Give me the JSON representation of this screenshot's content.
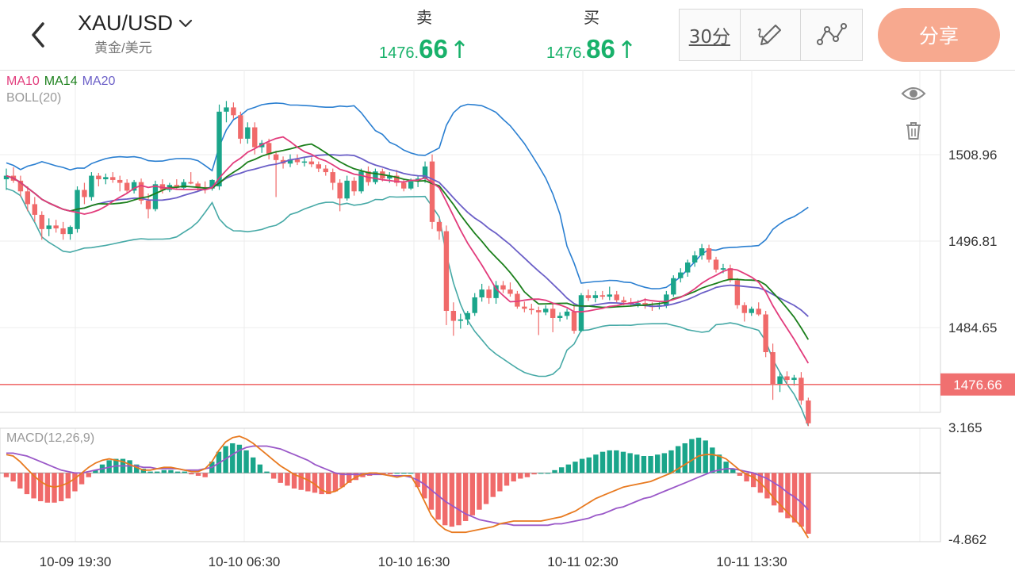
{
  "header": {
    "symbol": "XAU/USD",
    "symbol_sub": "黄金/美元",
    "sell": {
      "label": "卖",
      "price_prefix": "1476.",
      "price_main": "66",
      "arrow": "↑"
    },
    "buy": {
      "label": "买",
      "price_prefix": "1476.",
      "price_main": "86",
      "arrow": "↑"
    },
    "period": "30分",
    "share": "分享"
  },
  "colors": {
    "up": "#18b16a",
    "candle_up": "#1aa58a",
    "candle_down": "#f06a6a",
    "ma10": "#e23c7c",
    "ma14": "#1b7f1b",
    "ma20": "#6b5fc7",
    "boll_upper": "#2a7fd1",
    "boll_lower": "#46a9a6",
    "dif": "#e87a20",
    "dea": "#9a58c8",
    "price_line": "#f07070",
    "share_bg": "#f7a98f"
  },
  "legend": {
    "ma10": "MA10",
    "ma14": "MA14",
    "ma20": "MA20",
    "boll": "BOLL(20)",
    "macd": "MACD(12,26,9)"
  },
  "icons": {
    "back": "chevron-left-icon",
    "dropdown": "chevron-down-icon",
    "draw": "pen-draw-icon",
    "indicator": "line-indicator-icon",
    "eye": "eye-icon",
    "trash": "trash-icon"
  },
  "chart_data": [
    {
      "type": "candlestick",
      "ylim": [
        1476.66,
        1508.96
      ],
      "y_ticks": [
        "1508.96",
        "1496.81",
        "1484.65"
      ],
      "current_price_label": "1476.66",
      "current_price": 1476.66,
      "x_tick_labels": [
        "10-09 19:30",
        "10-10 06:30",
        "10-10 16:30",
        "10-11 02:30",
        "10-11 13:30"
      ],
      "candles": [
        {
          "o": 1505.5,
          "h": 1507,
          "l": 1504,
          "c": 1506
        },
        {
          "o": 1506,
          "h": 1507.2,
          "l": 1505,
          "c": 1505.3
        },
        {
          "o": 1505.3,
          "h": 1506,
          "l": 1503,
          "c": 1503.8
        },
        {
          "o": 1503.8,
          "h": 1504.5,
          "l": 1501,
          "c": 1502
        },
        {
          "o": 1502,
          "h": 1503,
          "l": 1499.5,
          "c": 1500.5
        },
        {
          "o": 1500.5,
          "h": 1501,
          "l": 1497,
          "c": 1498.5
        },
        {
          "o": 1498.5,
          "h": 1500,
          "l": 1497.5,
          "c": 1499
        },
        {
          "o": 1499,
          "h": 1499.8,
          "l": 1498,
          "c": 1498.6
        },
        {
          "o": 1498.6,
          "h": 1499.5,
          "l": 1497,
          "c": 1497.8
        },
        {
          "o": 1497.8,
          "h": 1499,
          "l": 1497,
          "c": 1498.8
        },
        {
          "o": 1498.5,
          "h": 1504.5,
          "l": 1498,
          "c": 1504
        },
        {
          "o": 1504,
          "h": 1505,
          "l": 1502,
          "c": 1503
        },
        {
          "o": 1503,
          "h": 1506.5,
          "l": 1502.5,
          "c": 1506
        },
        {
          "o": 1506,
          "h": 1506.4,
          "l": 1504.5,
          "c": 1505.5
        },
        {
          "o": 1505.5,
          "h": 1506.3,
          "l": 1504.8,
          "c": 1505.8
        },
        {
          "o": 1505.8,
          "h": 1506.5,
          "l": 1505,
          "c": 1505.4
        },
        {
          "o": 1505.4,
          "h": 1506,
          "l": 1503.8,
          "c": 1505
        },
        {
          "o": 1505,
          "h": 1505.5,
          "l": 1503.5,
          "c": 1503.9
        },
        {
          "o": 1503.9,
          "h": 1505.4,
          "l": 1503.5,
          "c": 1505.1
        },
        {
          "o": 1505.1,
          "h": 1505.6,
          "l": 1502,
          "c": 1502.5
        },
        {
          "o": 1502.5,
          "h": 1503.5,
          "l": 1500,
          "c": 1501.3
        },
        {
          "o": 1501.3,
          "h": 1505.3,
          "l": 1501,
          "c": 1504.8
        },
        {
          "o": 1504.8,
          "h": 1505.5,
          "l": 1503.5,
          "c": 1504
        },
        {
          "o": 1504,
          "h": 1505,
          "l": 1503.7,
          "c": 1504.7
        },
        {
          "o": 1504.7,
          "h": 1505.5,
          "l": 1504,
          "c": 1504.3
        },
        {
          "o": 1504.3,
          "h": 1505.5,
          "l": 1504,
          "c": 1505.1
        },
        {
          "o": 1505.1,
          "h": 1506.5,
          "l": 1504.8,
          "c": 1504.9
        },
        {
          "o": 1504.9,
          "h": 1505.2,
          "l": 1503.8,
          "c": 1504.4
        },
        {
          "o": 1504.4,
          "h": 1505.2,
          "l": 1503.5,
          "c": 1504.2
        },
        {
          "o": 1504.2,
          "h": 1505.5,
          "l": 1503.9,
          "c": 1505.4
        },
        {
          "o": 1504.5,
          "h": 1516,
          "l": 1504,
          "c": 1515
        },
        {
          "o": 1515,
          "h": 1516.5,
          "l": 1513.5,
          "c": 1515.6
        },
        {
          "o": 1515.6,
          "h": 1516.3,
          "l": 1514,
          "c": 1514.5
        },
        {
          "o": 1514.5,
          "h": 1515,
          "l": 1510.5,
          "c": 1511.2
        },
        {
          "o": 1511.2,
          "h": 1513.5,
          "l": 1510.5,
          "c": 1512.8
        },
        {
          "o": 1512.8,
          "h": 1513.5,
          "l": 1509,
          "c": 1510
        },
        {
          "o": 1510,
          "h": 1511,
          "l": 1509.2,
          "c": 1510.6
        },
        {
          "o": 1510.6,
          "h": 1511.2,
          "l": 1508.3,
          "c": 1509
        },
        {
          "o": 1509,
          "h": 1509.5,
          "l": 1503,
          "c": 1508.2
        },
        {
          "o": 1508.2,
          "h": 1508.7,
          "l": 1507,
          "c": 1507.7
        },
        {
          "o": 1507.7,
          "h": 1509,
          "l": 1507.2,
          "c": 1508.3
        },
        {
          "o": 1508.3,
          "h": 1509,
          "l": 1507.5,
          "c": 1507.9
        },
        {
          "o": 1507.9,
          "h": 1508.5,
          "l": 1507.3,
          "c": 1508
        },
        {
          "o": 1508,
          "h": 1508.6,
          "l": 1507.2,
          "c": 1507.6
        },
        {
          "o": 1507.6,
          "h": 1508,
          "l": 1506.5,
          "c": 1507
        },
        {
          "o": 1507,
          "h": 1507.5,
          "l": 1506,
          "c": 1506.5
        },
        {
          "o": 1506.5,
          "h": 1507,
          "l": 1504,
          "c": 1505
        },
        {
          "o": 1505,
          "h": 1505.5,
          "l": 1501,
          "c": 1502.8
        },
        {
          "o": 1502.8,
          "h": 1506,
          "l": 1502.5,
          "c": 1505.3
        },
        {
          "o": 1505.3,
          "h": 1505.8,
          "l": 1503.2,
          "c": 1503.8
        },
        {
          "o": 1503.8,
          "h": 1507,
          "l": 1503.5,
          "c": 1506.6
        },
        {
          "o": 1506.6,
          "h": 1507.3,
          "l": 1504.6,
          "c": 1505.1
        },
        {
          "o": 1505.1,
          "h": 1507,
          "l": 1504.8,
          "c": 1506.6
        },
        {
          "o": 1506.6,
          "h": 1507,
          "l": 1505.2,
          "c": 1505.6
        },
        {
          "o": 1505.6,
          "h": 1506.5,
          "l": 1505,
          "c": 1506
        },
        {
          "o": 1506,
          "h": 1506.8,
          "l": 1504.5,
          "c": 1505
        },
        {
          "o": 1505,
          "h": 1505.5,
          "l": 1503.8,
          "c": 1504.2
        },
        {
          "o": 1504.2,
          "h": 1505.6,
          "l": 1504,
          "c": 1505.2
        },
        {
          "o": 1505.2,
          "h": 1506,
          "l": 1504.4,
          "c": 1505.6
        },
        {
          "o": 1505.6,
          "h": 1508,
          "l": 1505,
          "c": 1507.3
        },
        {
          "o": 1508,
          "h": 1509,
          "l": 1498.5,
          "c": 1499.5
        },
        {
          "o": 1499.5,
          "h": 1500,
          "l": 1497,
          "c": 1498.2
        },
        {
          "o": 1498.2,
          "h": 1499,
          "l": 1485,
          "c": 1487
        },
        {
          "o": 1487,
          "h": 1488.2,
          "l": 1483.5,
          "c": 1485.6
        },
        {
          "o": 1485.6,
          "h": 1486.6,
          "l": 1484.5,
          "c": 1485.8
        },
        {
          "o": 1485.8,
          "h": 1487,
          "l": 1485,
          "c": 1486.7
        },
        {
          "o": 1486.7,
          "h": 1489.5,
          "l": 1486.3,
          "c": 1488.9
        },
        {
          "o": 1488.9,
          "h": 1490.8,
          "l": 1488.3,
          "c": 1490
        },
        {
          "o": 1490,
          "h": 1490.5,
          "l": 1488,
          "c": 1488.8
        },
        {
          "o": 1488.8,
          "h": 1491.2,
          "l": 1488,
          "c": 1490.6
        },
        {
          "o": 1490.6,
          "h": 1491.2,
          "l": 1489.5,
          "c": 1490
        },
        {
          "o": 1490,
          "h": 1491,
          "l": 1489,
          "c": 1489.4
        },
        {
          "o": 1489.4,
          "h": 1489.8,
          "l": 1487.3,
          "c": 1487.6
        },
        {
          "o": 1487.6,
          "h": 1488.3,
          "l": 1486.8,
          "c": 1487.3
        },
        {
          "o": 1487.3,
          "h": 1488,
          "l": 1486.5,
          "c": 1487.1
        },
        {
          "o": 1487.1,
          "h": 1487.6,
          "l": 1483.6,
          "c": 1486.8
        },
        {
          "o": 1486.8,
          "h": 1487.8,
          "l": 1486.4,
          "c": 1487.3
        },
        {
          "o": 1487.3,
          "h": 1488,
          "l": 1484,
          "c": 1486
        },
        {
          "o": 1486,
          "h": 1486.8,
          "l": 1485.5,
          "c": 1486.3
        },
        {
          "o": 1486.3,
          "h": 1487.3,
          "l": 1485.8,
          "c": 1486.9
        },
        {
          "o": 1486.9,
          "h": 1488,
          "l": 1483.8,
          "c": 1484.2
        },
        {
          "o": 1484.2,
          "h": 1489.5,
          "l": 1484,
          "c": 1489.2
        },
        {
          "o": 1489.2,
          "h": 1490,
          "l": 1488.4,
          "c": 1488.8
        },
        {
          "o": 1488.8,
          "h": 1489.8,
          "l": 1488.2,
          "c": 1489.2
        },
        {
          "o": 1489.2,
          "h": 1489.8,
          "l": 1488.6,
          "c": 1489
        },
        {
          "o": 1489,
          "h": 1490.4,
          "l": 1488.5,
          "c": 1489.3
        },
        {
          "o": 1489.3,
          "h": 1489.8,
          "l": 1488.2,
          "c": 1488.5
        },
        {
          "o": 1488.5,
          "h": 1489,
          "l": 1487.8,
          "c": 1488.2
        },
        {
          "o": 1488.2,
          "h": 1488.8,
          "l": 1487.6,
          "c": 1487.9
        },
        {
          "o": 1487.9,
          "h": 1488.5,
          "l": 1487.5,
          "c": 1488.1
        },
        {
          "o": 1488.1,
          "h": 1488.8,
          "l": 1487.3,
          "c": 1487.7
        },
        {
          "o": 1487.7,
          "h": 1488.2,
          "l": 1487,
          "c": 1487.6
        },
        {
          "o": 1487.6,
          "h": 1488.2,
          "l": 1487.2,
          "c": 1487.8
        },
        {
          "o": 1487.8,
          "h": 1489.8,
          "l": 1487.4,
          "c": 1489.3
        },
        {
          "o": 1489.3,
          "h": 1492,
          "l": 1489,
          "c": 1491.6
        },
        {
          "o": 1491.6,
          "h": 1493,
          "l": 1491,
          "c": 1492.4
        },
        {
          "o": 1492.4,
          "h": 1494.2,
          "l": 1491.8,
          "c": 1493.8
        },
        {
          "o": 1493.8,
          "h": 1495.4,
          "l": 1493.2,
          "c": 1494.8
        },
        {
          "o": 1494.8,
          "h": 1496.4,
          "l": 1494.2,
          "c": 1495.8
        },
        {
          "o": 1495.8,
          "h": 1496.3,
          "l": 1493.8,
          "c": 1494.2
        },
        {
          "o": 1494.2,
          "h": 1494.6,
          "l": 1492.4,
          "c": 1492.8
        },
        {
          "o": 1492.8,
          "h": 1493.6,
          "l": 1492.3,
          "c": 1493
        },
        {
          "o": 1493,
          "h": 1493.5,
          "l": 1491,
          "c": 1491.3
        },
        {
          "o": 1491.3,
          "h": 1491.6,
          "l": 1487.3,
          "c": 1487.8
        },
        {
          "o": 1487.8,
          "h": 1488.2,
          "l": 1485.5,
          "c": 1486.7
        },
        {
          "o": 1486.7,
          "h": 1487.6,
          "l": 1486.3,
          "c": 1487.3
        },
        {
          "o": 1487.3,
          "h": 1488.2,
          "l": 1486.3,
          "c": 1486.5
        },
        {
          "o": 1486.5,
          "h": 1487,
          "l": 1480.5,
          "c": 1481.2
        },
        {
          "o": 1481.2,
          "h": 1482.4,
          "l": 1474.5,
          "c": 1476.6
        },
        {
          "o": 1476.6,
          "h": 1478.4,
          "l": 1475.6,
          "c": 1477.8
        },
        {
          "o": 1477.8,
          "h": 1478.5,
          "l": 1476.8,
          "c": 1477.3
        },
        {
          "o": 1477.3,
          "h": 1478,
          "l": 1476.5,
          "c": 1477.6
        },
        {
          "o": 1477.6,
          "h": 1478.4,
          "l": 1473.8,
          "c": 1474.4
        },
        {
          "o": 1474.4,
          "h": 1474.8,
          "l": 1470.8,
          "c": 1471.2
        }
      ]
    },
    {
      "type": "bar",
      "name": "MACD(12,26,9)",
      "ylim": [
        -4.862,
        3.165
      ],
      "y_ticks": [
        "3.165",
        "-4.862"
      ],
      "hist": [
        -0.3,
        -0.6,
        -1.1,
        -1.5,
        -1.8,
        -2,
        -2.1,
        -2.1,
        -2,
        -1.8,
        -1.3,
        -0.8,
        -0.3,
        0.2,
        0.6,
        0.9,
        1,
        1,
        0.9,
        0.6,
        0.3,
        0.1,
        0.1,
        0.2,
        0.2,
        0.1,
        0.1,
        -0.1,
        -0.2,
        -0.3,
        0.8,
        1.5,
        1.9,
        2.1,
        2,
        1.6,
        1.1,
        0.6,
        0.1,
        -0.4,
        -0.7,
        -0.9,
        -1.1,
        -1.2,
        -1.3,
        -1.4,
        -1.5,
        -1.5,
        -1.3,
        -1,
        -0.7,
        -0.5,
        -0.3,
        -0.2,
        -0.1,
        -0.1,
        -0.1,
        0,
        0,
        0,
        -1,
        -1.8,
        -2.6,
        -3.3,
        -3.7,
        -3.8,
        -3.7,
        -3.4,
        -3,
        -2.6,
        -2.2,
        -1.7,
        -1.3,
        -0.9,
        -0.6,
        -0.4,
        -0.3,
        -0.1,
        0,
        0,
        0.2,
        0.4,
        0.6,
        0.8,
        1,
        1.1,
        1.3,
        1.5,
        1.6,
        1.6,
        1.5,
        1.4,
        1.3,
        1.2,
        1.2,
        1.3,
        1.4,
        1.6,
        1.9,
        2.1,
        2.4,
        2.5,
        2.3,
        1.8,
        1.3,
        0.8,
        0.3,
        -0.2,
        -0.6,
        -1,
        -1.4,
        -1.8,
        -2.3,
        -2.8,
        -3.2,
        -3.5,
        -3.8,
        -4.3
      ],
      "dif": [
        1.3,
        1.2,
        0.8,
        0.3,
        -0.2,
        -0.6,
        -0.9,
        -1,
        -0.9,
        -0.7,
        -0.4,
        0,
        0.4,
        0.7,
        0.9,
        1,
        0.9,
        0.8,
        0.6,
        0.4,
        0.2,
        0.2,
        0.3,
        0.4,
        0.4,
        0.3,
        0.2,
        0.1,
        0.1,
        0.3,
        0.8,
        1.6,
        2.2,
        2.5,
        2.6,
        2.4,
        2.1,
        1.7,
        1.3,
        0.9,
        0.5,
        0.2,
        -0.1,
        -0.3,
        -0.5,
        -0.8,
        -1.2,
        -1.4,
        -1.3,
        -1,
        -0.6,
        -0.3,
        -0.1,
        0,
        0,
        -0.1,
        -0.2,
        -0.3,
        -0.2,
        -0.2,
        -1,
        -2,
        -3,
        -3.6,
        -4,
        -4.2,
        -4.2,
        -4.2,
        -4.1,
        -4,
        -3.9,
        -3.8,
        -3.6,
        -3.5,
        -3.4,
        -3.4,
        -3.4,
        -3.4,
        -3.4,
        -3.3,
        -3.2,
        -3.1,
        -2.9,
        -2.7,
        -2.4,
        -2.1,
        -1.8,
        -1.6,
        -1.4,
        -1.2,
        -1,
        -0.9,
        -0.8,
        -0.7,
        -0.6,
        -0.4,
        -0.2,
        0,
        0.3,
        0.6,
        0.9,
        1.2,
        1.3,
        1.3,
        1.2,
        1,
        0.6,
        0.2,
        -0.1,
        -0.3,
        -0.7,
        -1.2,
        -1.8,
        -2.3,
        -2.8,
        -3.3,
        -3.8,
        -4.6
      ],
      "dea": [
        1.4,
        1.4,
        1.3,
        1.2,
        1,
        0.8,
        0.6,
        0.4,
        0.2,
        0.1,
        0,
        0,
        0.1,
        0.2,
        0.3,
        0.4,
        0.5,
        0.5,
        0.5,
        0.5,
        0.4,
        0.4,
        0.3,
        0.3,
        0.3,
        0.3,
        0.2,
        0.2,
        0.2,
        0.3,
        0.4,
        0.7,
        1,
        1.3,
        1.6,
        1.8,
        1.9,
        1.9,
        1.9,
        1.8,
        1.7,
        1.5,
        1.3,
        1.1,
        0.9,
        0.6,
        0.4,
        0.2,
        0,
        -0.1,
        -0.1,
        -0.1,
        -0.1,
        -0.1,
        -0.1,
        -0.1,
        -0.2,
        -0.2,
        -0.2,
        -0.3,
        -0.5,
        -0.8,
        -1.2,
        -1.6,
        -2,
        -2.3,
        -2.6,
        -2.9,
        -3.1,
        -3.3,
        -3.4,
        -3.5,
        -3.6,
        -3.6,
        -3.7,
        -3.7,
        -3.7,
        -3.7,
        -3.7,
        -3.7,
        -3.6,
        -3.6,
        -3.5,
        -3.4,
        -3.3,
        -3.2,
        -3,
        -2.9,
        -2.7,
        -2.5,
        -2.4,
        -2.2,
        -2,
        -1.8,
        -1.7,
        -1.5,
        -1.3,
        -1.1,
        -0.9,
        -0.7,
        -0.5,
        -0.3,
        -0.1,
        0.1,
        0.2,
        0.3,
        0.3,
        0.2,
        0.1,
        0,
        -0.2,
        -0.4,
        -0.7,
        -1,
        -1.4,
        -1.7,
        -2.1,
        -2.6
      ]
    }
  ]
}
